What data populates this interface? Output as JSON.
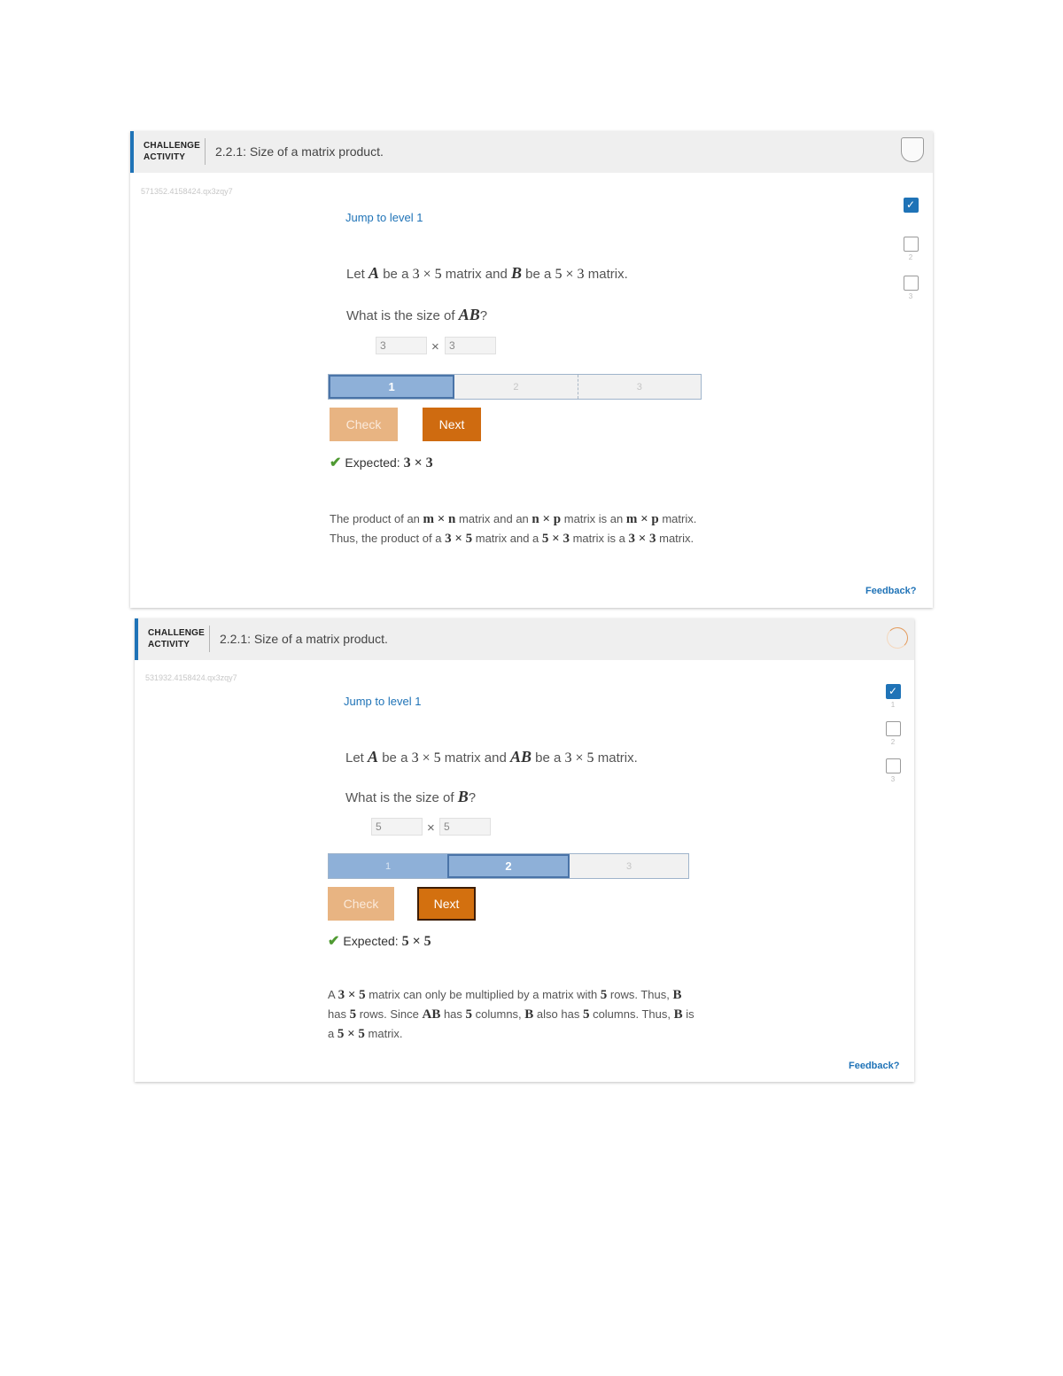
{
  "activities": [
    {
      "activity_type": "CHALLENGE ACTIVITY",
      "title": "2.2.1: Size of a matrix product.",
      "activity_id": "571352.4158424.qx3zqy7",
      "jump_link": "Jump to level 1",
      "question_line1": {
        "p1": "Let ",
        "v1": "A",
        "p2": " be a ",
        "v2": "3 × 5",
        "p3": " matrix and ",
        "v3": "B",
        "p4": " be a ",
        "v4": "5 × 3",
        "p5": " matrix."
      },
      "question_line2": {
        "p1": "What is the size of ",
        "v1": "AB",
        "p2": "?"
      },
      "answer_rows": "3",
      "answer_cols": "3",
      "times_symbol": "×",
      "levels": [
        "1",
        "2",
        "3"
      ],
      "current_level_index": 0,
      "check_label": "Check",
      "next_label": "Next",
      "expected_label": "Expected:",
      "expected_value": "3 × 3",
      "explanation": {
        "t1": "The product of an ",
        "m1": "m × n",
        "t2": " matrix and an ",
        "m2": "n × p",
        "t3": " matrix is an ",
        "m3": "m × p",
        "t4": " matrix. Thus, the product of a ",
        "m4": "3 × 5",
        "t5": " matrix and a ",
        "m5": "5 × 3",
        "t6": " matrix is a ",
        "m6": "3 × 3",
        "t7": " matrix."
      },
      "feedback": "Feedback?",
      "level_checks": [
        {
          "num": "1",
          "checked": true
        },
        {
          "num": "2",
          "checked": false
        },
        {
          "num": "3",
          "checked": false
        }
      ]
    },
    {
      "activity_type": "CHALLENGE ACTIVITY",
      "title": "2.2.1: Size of a matrix product.",
      "activity_id": "531932.4158424.qx3zqy7",
      "jump_link": "Jump to level 1",
      "question_line1": {
        "p1": "Let ",
        "v1": "A",
        "p2": " be a ",
        "v2": "3 × 5",
        "p3": " matrix and ",
        "v3": "AB",
        "p4": " be a ",
        "v4": "3 × 5",
        "p5": " matrix."
      },
      "question_line2": {
        "p1": "What is the size of ",
        "v1": "B",
        "p2": "?"
      },
      "answer_rows": "5",
      "answer_cols": "5",
      "times_symbol": "×",
      "levels": [
        "1",
        "2",
        "3"
      ],
      "current_level_index": 1,
      "check_label": "Check",
      "next_label": "Next",
      "expected_label": "Expected:",
      "expected_value": "5 × 5",
      "explanation": {
        "t1": "A ",
        "m1": "3 × 5",
        "t2": " matrix can only be multiplied by a matrix with ",
        "m2": "5",
        "t3": " rows. Thus, ",
        "m3": "B",
        "t4": " has ",
        "m4": "5",
        "t5": " rows. Since ",
        "m5": "AB",
        "t6": " has ",
        "m6": "5",
        "t7": " columns, ",
        "m7": "B",
        "t8": " also has ",
        "m8": "5",
        "t9": " columns. Thus, ",
        "m9": "B",
        "t10": " is a ",
        "m10": "5 × 5",
        "t11": " matrix."
      },
      "feedback": "Feedback?",
      "level_checks": [
        {
          "num": "1",
          "checked": true
        },
        {
          "num": "2",
          "checked": false
        },
        {
          "num": "3",
          "checked": false
        }
      ]
    }
  ],
  "colors": {
    "accent": "#1f73b7",
    "next_button": "#cf6b10",
    "check_button": "#e8b482",
    "level_bar": "#8eb0d8",
    "success": "#4f9a32"
  }
}
